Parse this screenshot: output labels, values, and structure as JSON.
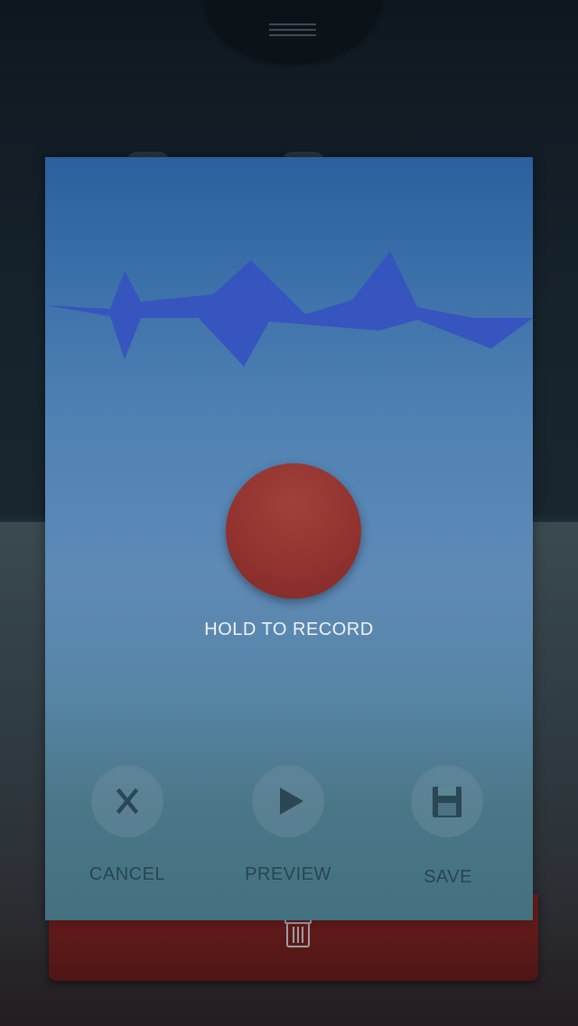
{
  "recorder": {
    "hint": "HOLD TO RECORD",
    "actions": {
      "cancel": {
        "label": "CANCEL",
        "icon": "close-icon"
      },
      "preview": {
        "label": "PREVIEW",
        "icon": "play-icon"
      },
      "save": {
        "label": "SAVE",
        "icon": "floppy-disk-icon"
      }
    }
  },
  "background": {
    "header_icon": "menu-icon",
    "footer_icon": "trash-icon"
  },
  "colors": {
    "panel_top": "#2c609e",
    "panel_bottom": "#44717f",
    "waveform": "#3553c0",
    "record_button": "#93332f",
    "delete_card": "#5e1818"
  }
}
